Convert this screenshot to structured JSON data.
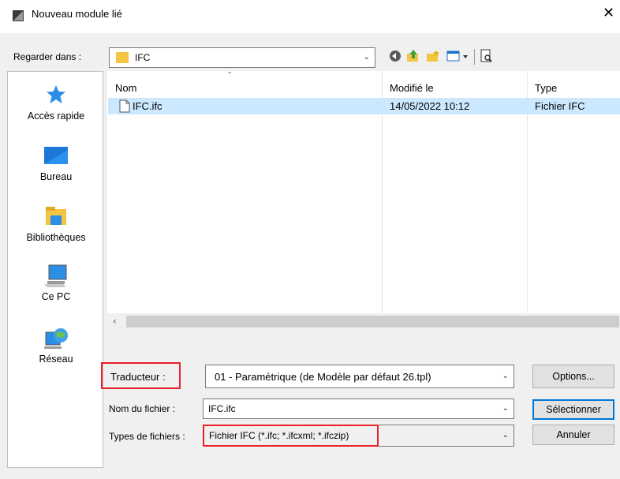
{
  "window": {
    "title": "Nouveau module lié",
    "close_glyph": "✕"
  },
  "lookin": {
    "label": "Regarder dans :",
    "value": "IFC"
  },
  "places": [
    {
      "label": "Accès rapide",
      "icon": "star-icon"
    },
    {
      "label": "Bureau",
      "icon": "desktop-icon"
    },
    {
      "label": "Bibliothèques",
      "icon": "libraries-icon"
    },
    {
      "label": "Ce PC",
      "icon": "computer-icon"
    },
    {
      "label": "Réseau",
      "icon": "network-icon"
    }
  ],
  "file_list": {
    "columns": [
      "Nom",
      "Modifié le",
      "Type"
    ],
    "rows": [
      {
        "name": "IFC.ifc",
        "modified": "14/05/2022 10:12",
        "type": "Fichier IFC",
        "selected": true
      }
    ]
  },
  "form": {
    "translator": {
      "label": "Traducteur :",
      "value": "01 - Paramétrique (de Modèle par défaut 26.tpl)"
    },
    "filename": {
      "label": "Nom du fichier :",
      "value": "IFC.ifc"
    },
    "filetype": {
      "label": "Types de fichiers :",
      "value": "Fichier IFC (*.ifc; *.ifcxml; *.ifczip)"
    }
  },
  "buttons": {
    "options": "Options...",
    "select": "Sélectionner",
    "cancel": "Annuler"
  },
  "colors": {
    "highlight_box": "#e8212b",
    "selection": "#cce8ff",
    "default_button_border": "#0078d7"
  }
}
